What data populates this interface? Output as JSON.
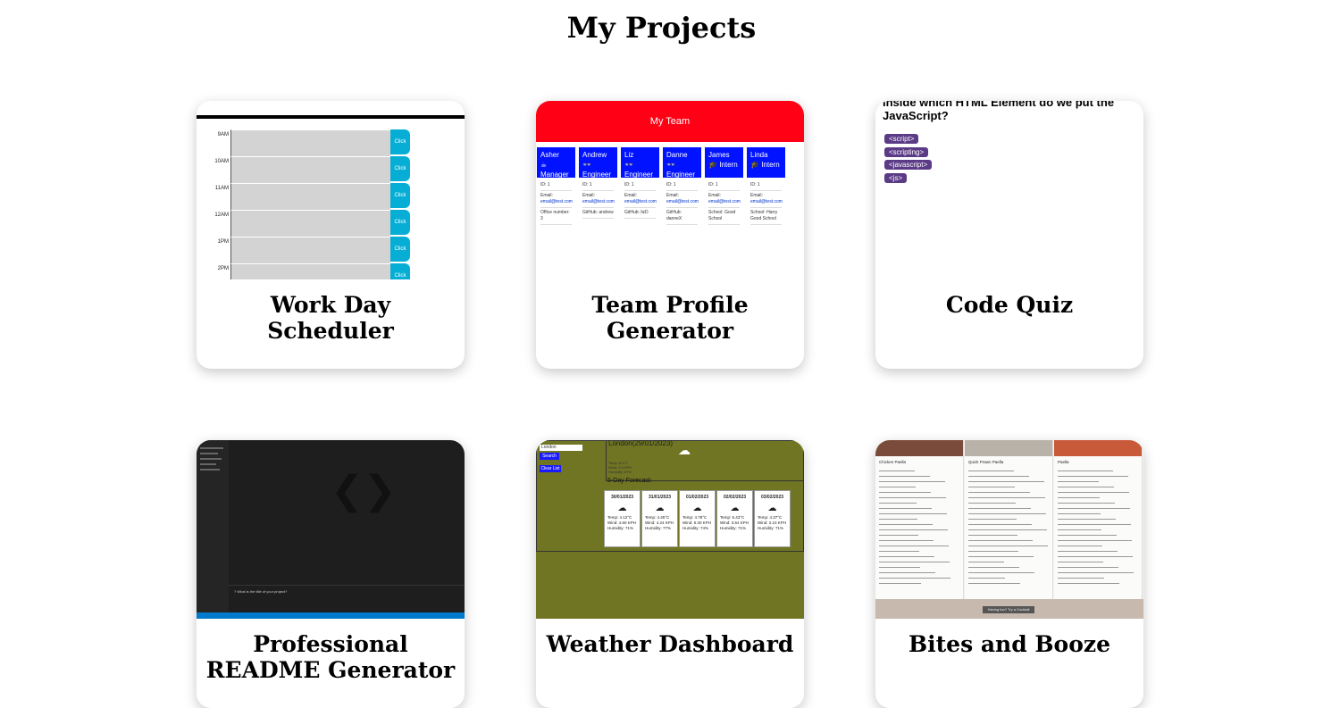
{
  "page": {
    "title": "My Projects"
  },
  "projects": [
    {
      "title": "Work Day Scheduler"
    },
    {
      "title": "Team Profile Generator"
    },
    {
      "title": "Code Quiz"
    },
    {
      "title": "Professional README Generator"
    },
    {
      "title": "Weather Dashboard"
    },
    {
      "title": "Bites and Booze"
    }
  ],
  "scheduler": {
    "hours": [
      "9AM",
      "10AM",
      "11AM",
      "12AM",
      "1PM",
      "2PM"
    ],
    "button_label": "Click"
  },
  "team": {
    "header": "My Team",
    "members": [
      {
        "name": "Asher",
        "role": "Manager",
        "icon": "coffee-icon",
        "glyph": "☕",
        "field3": "Office number: 3"
      },
      {
        "name": "Andrew",
        "role": "Engineer",
        "icon": "glasses-icon",
        "glyph": "👓",
        "field3": "GitHub: andrew"
      },
      {
        "name": "Liz",
        "role": "Engineer",
        "icon": "glasses-icon",
        "glyph": "👓",
        "field3": "GitHub: lizD"
      },
      {
        "name": "Danne",
        "role": "Engineer",
        "icon": "glasses-icon",
        "glyph": "👓",
        "field3": "GitHub: danneX"
      },
      {
        "name": "James",
        "role": "Intern",
        "icon": "graduate-icon",
        "glyph": "🎓",
        "field3": "School: Good School"
      },
      {
        "name": "Linda",
        "role": "Intern",
        "icon": "graduate-icon",
        "glyph": "🎓",
        "field3": "School: Harry Good School"
      }
    ],
    "id_label": "ID: 1",
    "email_label": "Email:",
    "email_value": "email@test.com"
  },
  "quiz": {
    "question": "Inside which HTML Element do we put the JavaScript?",
    "answers": [
      "<script>",
      "<scripting>",
      "<javascript>",
      "<js>"
    ]
  },
  "readme": {
    "terminal_text": "? What is the title of your project?"
  },
  "weather": {
    "input_placeholder": "London",
    "search_label": "Search",
    "clear_label": "Clear List",
    "city_date": "London(29/01/2023)",
    "current": [
      "Temp: 8.1°C",
      "Wind: 2.0 KPH",
      "Humidity: 87%"
    ],
    "forecast_title": "5-Day Forecast:",
    "forecast": [
      {
        "date": "30/01/2023",
        "temp": "Temp: 4.12°C",
        "wind": "Wind: 4.60 KPH",
        "humidity": "Humidity: 71%"
      },
      {
        "date": "31/01/2023",
        "temp": "Temp: 4.45°C",
        "wind": "Wind: 4.24 KPH",
        "humidity": "Humidity: 77%"
      },
      {
        "date": "01/02/2023",
        "temp": "Temp: 4.78°C",
        "wind": "Wind: 5.30 KPH",
        "humidity": "Humidity: 74%"
      },
      {
        "date": "02/02/2023",
        "temp": "Temp: 5.43°C",
        "wind": "Wind: 3.64 KPH",
        "humidity": "Humidity: 71%"
      },
      {
        "date": "03/02/2023",
        "temp": "Temp: 4.37°C",
        "wind": "Wind: 2.10 KPH",
        "humidity": "Humidity: 71%"
      }
    ]
  },
  "bites": {
    "columns": [
      {
        "title": "Chicken Paella",
        "photo_color": "#7a4a3a"
      },
      {
        "title": "Quick Prawn Paella",
        "photo_color": "#b8b2a8"
      },
      {
        "title": "Paella",
        "photo_color": "#c85a3a"
      }
    ],
    "footer_button": "Having fun? Try a Cocktail"
  }
}
